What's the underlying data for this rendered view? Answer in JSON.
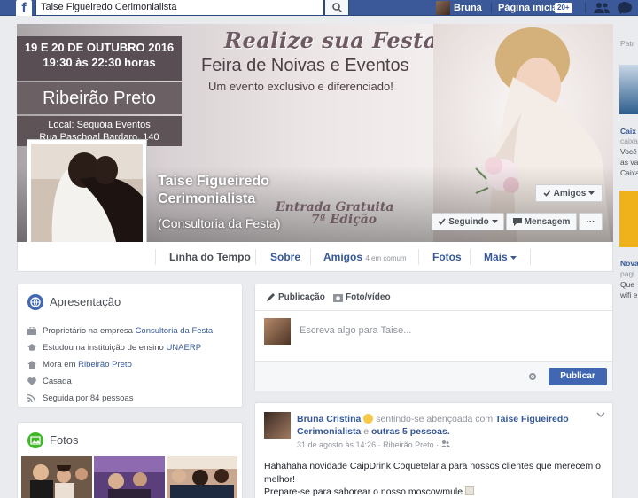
{
  "topbar": {
    "search_value": "Taise Figueiredo Cerimonialista",
    "user_name": "Bruna",
    "home_label": "Página inicial",
    "home_badge": "20+"
  },
  "cover": {
    "date_line": "19 E 20 DE OUTUBRO 2016",
    "time_line": "19:30 às 22:30 horas",
    "city": "Ribeirão Preto",
    "local_line1": "Local: Sequóia Eventos",
    "local_line2": "Rua Paschoal Bardaro, 140",
    "headline": "Realize sua Festa",
    "subheadline": "Feira de Noivas e Eventos",
    "tagline": "Um evento  exclusivo e diferenciado!",
    "free_line1": "Entrada Gratuita",
    "free_line2": "7ª Edição"
  },
  "profile": {
    "name_line1": "Taise Figueiredo",
    "name_line2": "Cerimonialista",
    "subtitle": "(Consultoria da Festa)"
  },
  "actions": {
    "friends": "Amigos",
    "following": "Seguindo",
    "message": "Mensagem",
    "more": "···"
  },
  "tabs": [
    {
      "label": "Linha do Tempo"
    },
    {
      "label": "Sobre"
    },
    {
      "label": "Amigos",
      "note": "4 em comum"
    },
    {
      "label": "Fotos"
    },
    {
      "label": "Mais"
    }
  ],
  "intro": {
    "title": "Apresentação",
    "rows": [
      {
        "prefix": "Proprietário na empresa ",
        "link": "Consultoria da Festa"
      },
      {
        "prefix": "Estudou na instituição de ensino ",
        "link": "UNAERP"
      },
      {
        "prefix": "Mora em ",
        "link": "Ribeirão Preto"
      },
      {
        "prefix": "Casada",
        "link": ""
      },
      {
        "prefix": "Seguida por 84 pessoas",
        "link": ""
      }
    ]
  },
  "photos": {
    "title": "Fotos"
  },
  "composer": {
    "tab_post": "Publicação",
    "tab_photo": "Foto/vídeo",
    "placeholder": "Escreva algo para Taise...",
    "publish": "Publicar"
  },
  "post": {
    "author": "Bruna Cristina",
    "feeling": "sentindo-se abençoada com",
    "tagged": "Taise Figueiredo Cerimonialista",
    "and": "e",
    "others": "outras 5 pessoas.",
    "timestamp": "31 de agosto às 14:26 · Ribeirão Preto ·",
    "body_line1": "Hahahaha novidade CaipDrink Coquetelaria para nossos clientes que merecem o melhor!",
    "body_line2": "Prepare-se para saborear o nosso moscowmule"
  },
  "right_sidebar": {
    "t1": "Patr",
    "t2": "Caix",
    "t3": "caixa",
    "t4": "Você",
    "t5": "as va",
    "t6": "Caixa",
    "t7": "Nova",
    "t8": "pagi",
    "t9": "Que",
    "t10": "wifi e"
  },
  "colors": {
    "brand": "#3b5998",
    "link": "#365899",
    "button_primary": "#4267b2"
  }
}
